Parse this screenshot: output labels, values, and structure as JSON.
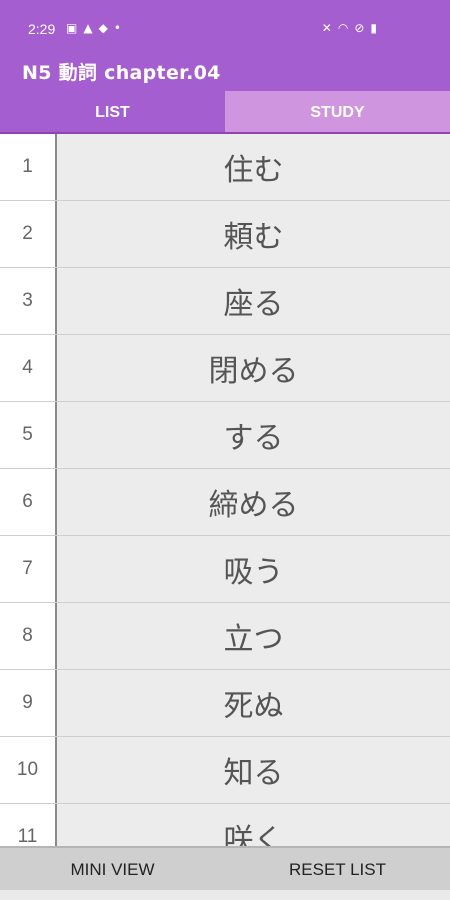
{
  "status_bar": {
    "time": "2:29",
    "left_icons": [
      "image-icon",
      "warning-icon",
      "bag-icon",
      "dot-icon"
    ],
    "right_icons": [
      "mute-icon",
      "wifi-icon",
      "blocked-icon",
      "battery-icon"
    ]
  },
  "app_bar": {
    "title": "N5 動詞 chapter.04"
  },
  "tabs": [
    {
      "label": "LIST",
      "active": true
    },
    {
      "label": "STUDY",
      "active": false
    }
  ],
  "list": {
    "items": [
      {
        "num": "1",
        "word": "住む"
      },
      {
        "num": "2",
        "word": "頼む"
      },
      {
        "num": "3",
        "word": "座る"
      },
      {
        "num": "4",
        "word": "閉める"
      },
      {
        "num": "5",
        "word": "する"
      },
      {
        "num": "6",
        "word": "締める"
      },
      {
        "num": "7",
        "word": "吸う"
      },
      {
        "num": "8",
        "word": "立つ"
      },
      {
        "num": "9",
        "word": "死ぬ"
      },
      {
        "num": "10",
        "word": "知る"
      },
      {
        "num": "11",
        "word": "咲く"
      }
    ]
  },
  "bottom_bar": {
    "mini_view_label": "MINI VIEW",
    "reset_list_label": "RESET LIST"
  },
  "colors": {
    "primary": "#a55ecf",
    "tab_inactive": "#cf96df",
    "row_bg": "#ececec"
  }
}
